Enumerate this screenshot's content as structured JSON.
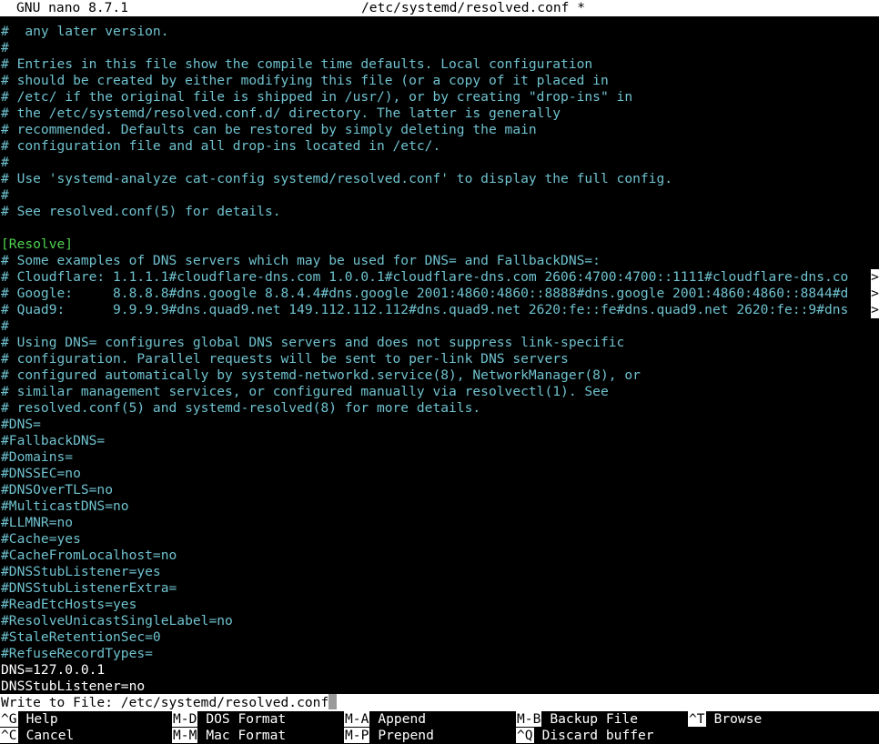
{
  "title_bar": {
    "app": "GNU nano 8.7.1",
    "file": "/etc/systemd/resolved.conf *"
  },
  "editor": {
    "lines": [
      {
        "text": "#  any later version.",
        "kind": "comment"
      },
      {
        "text": "#",
        "kind": "comment"
      },
      {
        "text": "# Entries in this file show the compile time defaults. Local configuration",
        "kind": "comment"
      },
      {
        "text": "# should be created by either modifying this file (or a copy of it placed in",
        "kind": "comment"
      },
      {
        "text": "# /etc/ if the original file is shipped in /usr/), or by creating \"drop-ins\" in",
        "kind": "comment"
      },
      {
        "text": "# the /etc/systemd/resolved.conf.d/ directory. The latter is generally",
        "kind": "comment"
      },
      {
        "text": "# recommended. Defaults can be restored by simply deleting the main",
        "kind": "comment"
      },
      {
        "text": "# configuration file and all drop-ins located in /etc/.",
        "kind": "comment"
      },
      {
        "text": "#",
        "kind": "comment"
      },
      {
        "text": "# Use 'systemd-analyze cat-config systemd/resolved.conf' to display the full config.",
        "kind": "comment"
      },
      {
        "text": "#",
        "kind": "comment"
      },
      {
        "text": "# See resolved.conf(5) for details.",
        "kind": "comment"
      },
      {
        "text": "",
        "kind": "plain"
      },
      {
        "text": "[Resolve]",
        "kind": "section"
      },
      {
        "text": "# Some examples of DNS servers which may be used for DNS= and FallbackDNS=:",
        "kind": "comment"
      },
      {
        "text": "# Cloudflare: 1.1.1.1#cloudflare-dns.com 1.0.0.1#cloudflare-dns.com 2606:4700:4700::1111#cloudflare-dns.co",
        "kind": "comment",
        "truncated": true
      },
      {
        "text": "# Google:     8.8.8.8#dns.google 8.8.4.4#dns.google 2001:4860:4860::8888#dns.google 2001:4860:4860::8844#d",
        "kind": "comment",
        "truncated": true
      },
      {
        "text": "# Quad9:      9.9.9.9#dns.quad9.net 149.112.112.112#dns.quad9.net 2620:fe::fe#dns.quad9.net 2620:fe::9#dns",
        "kind": "comment",
        "truncated": true
      },
      {
        "text": "#",
        "kind": "comment"
      },
      {
        "text": "# Using DNS= configures global DNS servers and does not suppress link-specific",
        "kind": "comment"
      },
      {
        "text": "# configuration. Parallel requests will be sent to per-link DNS servers",
        "kind": "comment"
      },
      {
        "text": "# configured automatically by systemd-networkd.service(8), NetworkManager(8), or",
        "kind": "comment"
      },
      {
        "text": "# similar management services, or configured manually via resolvectl(1). See",
        "kind": "comment"
      },
      {
        "text": "# resolved.conf(5) and systemd-resolved(8) for more details.",
        "kind": "comment"
      },
      {
        "text": "#DNS=",
        "kind": "comment"
      },
      {
        "text": "#FallbackDNS=",
        "kind": "comment"
      },
      {
        "text": "#Domains=",
        "kind": "comment"
      },
      {
        "text": "#DNSSEC=no",
        "kind": "comment"
      },
      {
        "text": "#DNSOverTLS=no",
        "kind": "comment"
      },
      {
        "text": "#MulticastDNS=no",
        "kind": "comment"
      },
      {
        "text": "#LLMNR=no",
        "kind": "comment"
      },
      {
        "text": "#Cache=yes",
        "kind": "comment"
      },
      {
        "text": "#CacheFromLocalhost=no",
        "kind": "comment"
      },
      {
        "text": "#DNSStubListener=yes",
        "kind": "comment"
      },
      {
        "text": "#DNSStubListenerExtra=",
        "kind": "comment"
      },
      {
        "text": "#ReadEtcHosts=yes",
        "kind": "comment"
      },
      {
        "text": "#ResolveUnicastSingleLabel=no",
        "kind": "comment"
      },
      {
        "text": "#StaleRetentionSec=0",
        "kind": "comment"
      },
      {
        "text": "#RefuseRecordTypes=",
        "kind": "comment"
      },
      {
        "text": "DNS=127.0.0.1",
        "kind": "plain"
      },
      {
        "text": "DNSStubListener=no",
        "kind": "plain"
      }
    ],
    "truncation_marker": ">"
  },
  "prompt": {
    "label": "Write to File: ",
    "value": "/etc/systemd/resolved.conf"
  },
  "shortcuts": [
    {
      "key": "^G",
      "label": "Help"
    },
    {
      "key": "M-D",
      "label": "DOS Format"
    },
    {
      "key": "M-A",
      "label": "Append"
    },
    {
      "key": "M-B",
      "label": "Backup File"
    },
    {
      "key": "^T",
      "label": "Browse"
    },
    {
      "key": "^C",
      "label": "Cancel"
    },
    {
      "key": "M-M",
      "label": "Mac Format"
    },
    {
      "key": "M-P",
      "label": "Prepend"
    },
    {
      "key": "^Q",
      "label": "Discard buffer"
    }
  ],
  "colors": {
    "comment": "#6fc2cf",
    "section": "#4fd14f",
    "plain": "#ffffff",
    "background": "#000000",
    "inverse_bg": "#ffffff",
    "inverse_fg": "#000000"
  }
}
